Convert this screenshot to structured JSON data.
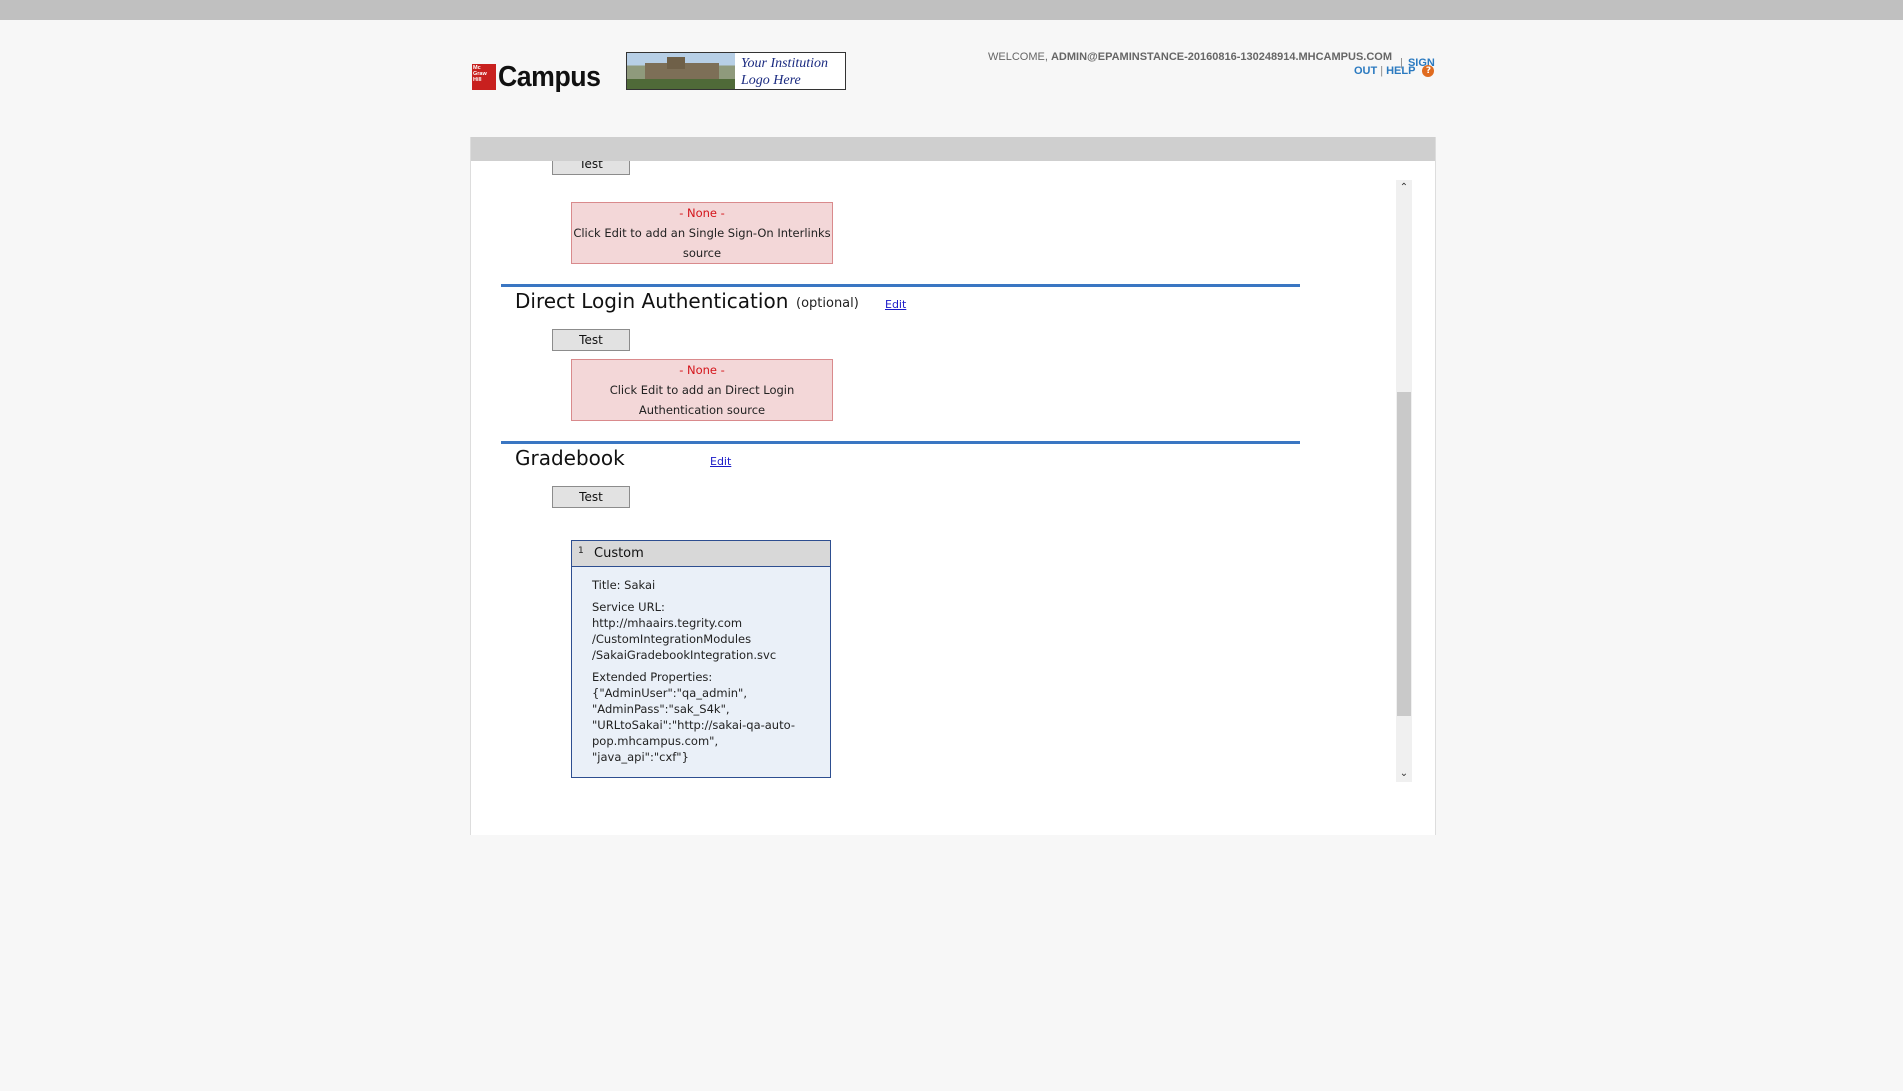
{
  "header": {
    "brand_badge": "Mc Graw Hill",
    "brand_name": "Campus",
    "institution_logo_text": "Your Institution Logo Here",
    "welcome_label": "WELCOME,",
    "user_email": "ADMIN@EPAMINSTANCE-20160816-130248914.MHCAMPUS.COM",
    "sign_label": "SIGN",
    "out_label": "OUT",
    "help_label": "HELP",
    "help_icon_glyph": "?"
  },
  "sso": {
    "test_label": "Test",
    "none_label": "- None -",
    "message": "Click Edit to add an Single Sign-On Interlinks source"
  },
  "direct_login": {
    "title": "Direct Login Authentication",
    "optional_label": "(optional)",
    "edit_label": "Edit",
    "test_label": "Test",
    "none_label": "- None -",
    "message": "Click Edit to add an Direct Login Authentication source"
  },
  "gradebook": {
    "title": "Gradebook",
    "edit_label": "Edit",
    "test_label": "Test",
    "entry": {
      "number": "1",
      "type": "Custom",
      "title_line": "Title: Sakai",
      "service_url_label": "Service URL:",
      "service_url_lines": [
        "http://mhaairs.tegrity.com",
        "/CustomIntegrationModules",
        "/SakaiGradebookIntegration.svc"
      ],
      "extended_label": "Extended Properties:",
      "extended_lines": [
        "{\"AdminUser\":\"qa_admin\",",
        "\"AdminPass\":\"sak_S4k\",",
        "\"URLtoSakai\":\"http://sakai-qa-auto-",
        "pop.mhcampus.com\",",
        "\"java_api\":\"cxf\"}"
      ]
    }
  },
  "scrollbar": {
    "up_glyph": "⌃",
    "down_glyph": "⌄"
  },
  "colors": {
    "section_rule": "#3a76c2",
    "none_text": "#d4141a",
    "link": "#2b7ac0"
  }
}
